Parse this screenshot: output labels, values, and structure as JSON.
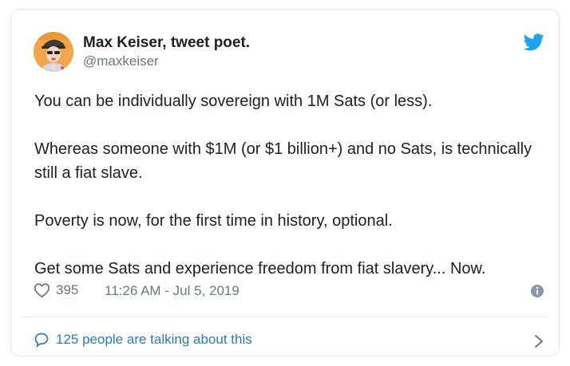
{
  "tweet": {
    "author": {
      "display_name": "Max Keiser, tweet poet.",
      "handle": "@maxkeiser",
      "avatar_icon": "user-avatar"
    },
    "brand_icon": "twitter-bird-icon",
    "paragraphs": [
      "You can be individually sovereign with 1M Sats (or less).",
      "Whereas someone with $1M (or $1 billion+) and no Sats, is technically still a fiat slave.",
      "Poverty is now, for the first time in history, optional.",
      "Get some Sats and experience freedom from fiat slavery... Now."
    ],
    "likes": "395",
    "timestamp": "11:26 AM - Jul 5, 2019",
    "conversation_label": "125 people are talking about this"
  },
  "colors": {
    "twitter_blue": "#1da1f2",
    "link_blue": "#2b7bb9",
    "muted_gray": "#697882",
    "text": "#1c2022",
    "border": "#e1e8ed"
  }
}
